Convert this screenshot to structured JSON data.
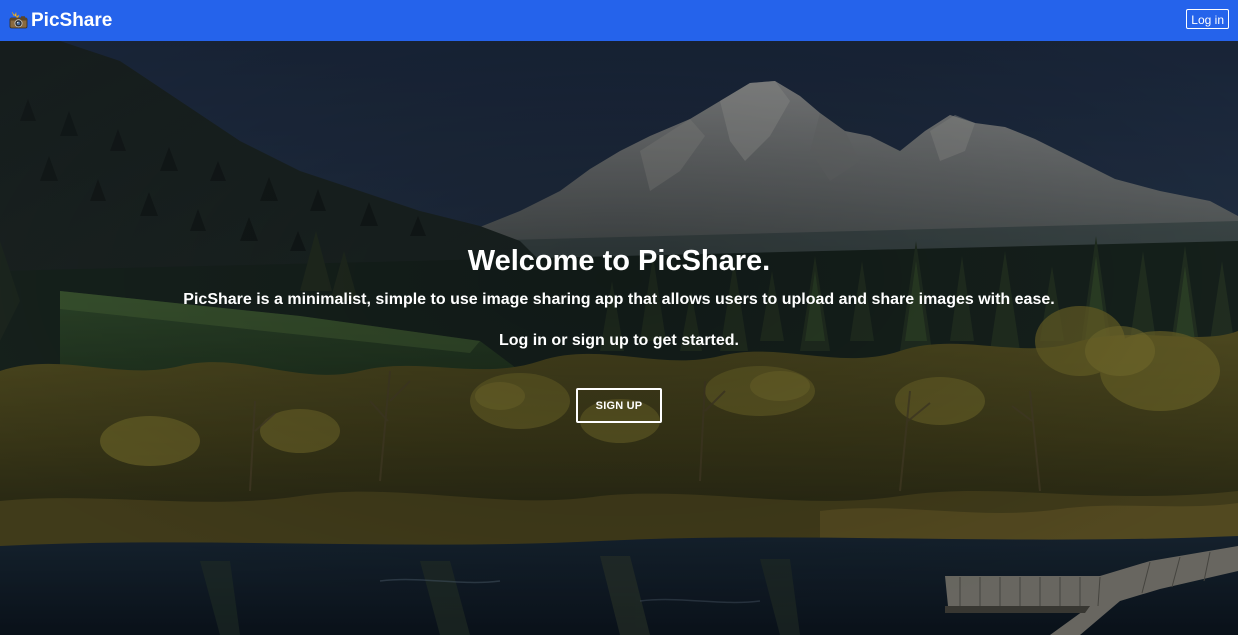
{
  "navbar": {
    "brand_name": "PicShare",
    "brand_icon": "camera-flash-icon",
    "login_label": "Log in",
    "background_color": "#2563eb"
  },
  "hero": {
    "background_image": "mountain-lake-forest-photo",
    "title": "Welcome to PicShare.",
    "description": "PicShare is a minimalist, simple to use image sharing app that allows users to upload and share images with ease.",
    "cta_text": "Log in or sign up to get started.",
    "signup_label": "SIGN UP"
  }
}
